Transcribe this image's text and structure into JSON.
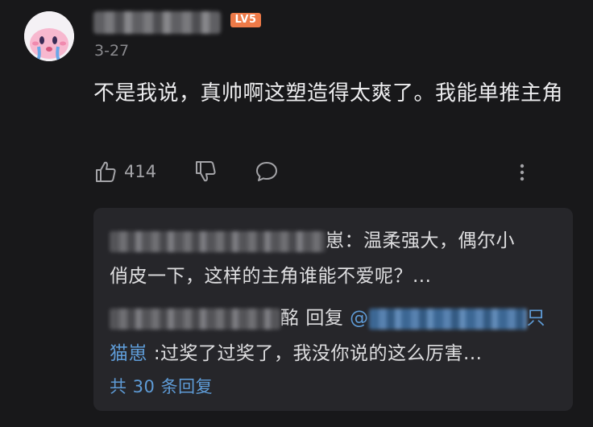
{
  "comment": {
    "date": "3-27",
    "level_badge": "LV5",
    "text": "不是我说，真帅啊这塑造得太爽了。我能单推主角",
    "likes": "414"
  },
  "replies": [
    {
      "author_visible_tail": "崽",
      "text_line1": "：温柔强大，偶尔小",
      "text_line2": "俏皮一下，这样的主角谁能不爱呢？..."
    },
    {
      "author_visible_tail": "酩",
      "reply_word": "回复",
      "target_prefix": "@",
      "target_tail": "只",
      "target_line2": "猫崽",
      "text": ":过奖了过奖了，我没你说的这么厉害..."
    }
  ],
  "more_replies": "共 30 条回复",
  "colors": {
    "background": "#18181a",
    "reply_box": "#26262a",
    "link_blue": "#5e9bd6",
    "badge_orange": "#ee7a48"
  },
  "icons": [
    "avatar",
    "thumbs-up-icon",
    "thumbs-down-icon",
    "comment-bubble-icon",
    "more-vertical-icon"
  ]
}
